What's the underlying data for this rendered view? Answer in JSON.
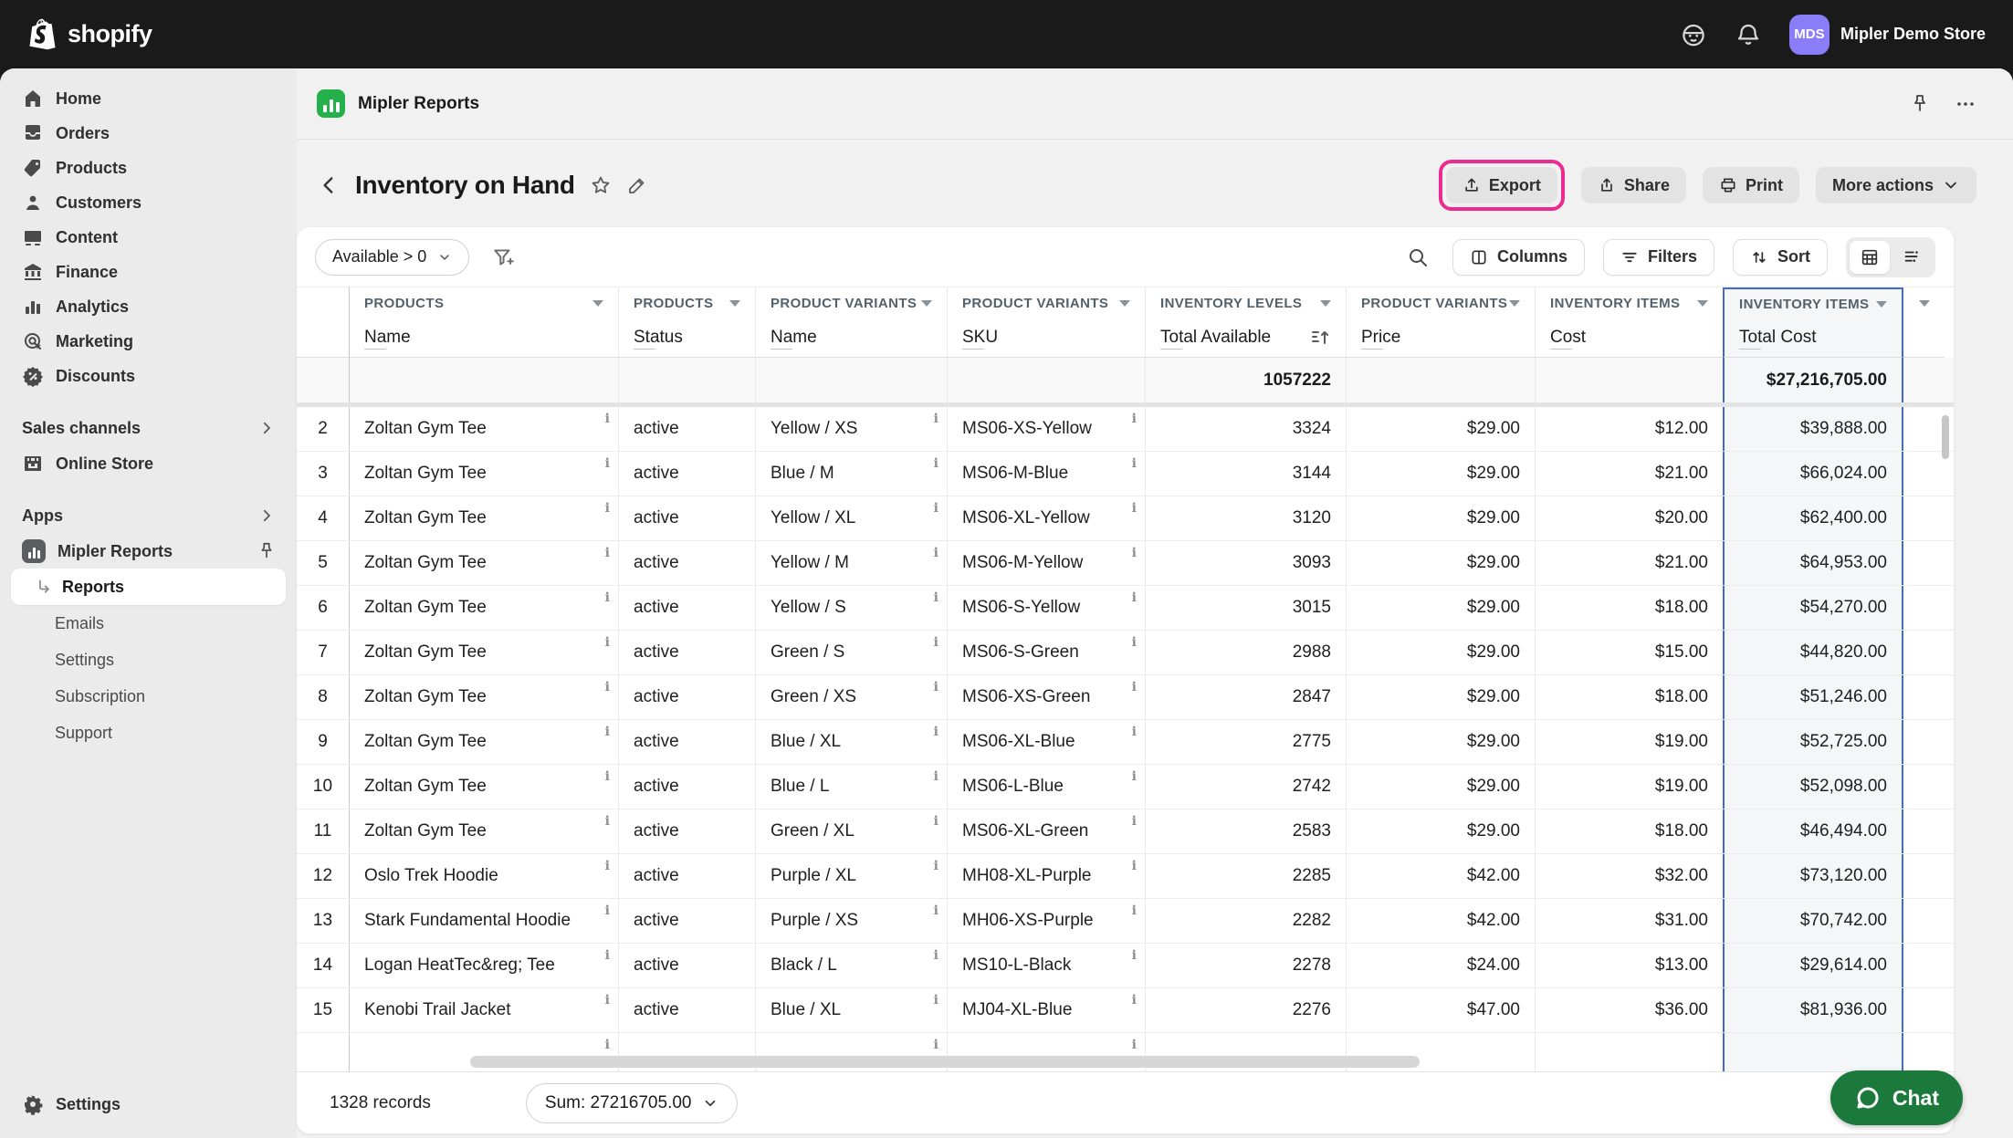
{
  "topbar": {
    "brand": "shopify",
    "store_name": "Mipler Demo Store",
    "store_initials": "MDS"
  },
  "sidebar": {
    "items": [
      {
        "label": "Home",
        "icon": "home-icon"
      },
      {
        "label": "Orders",
        "icon": "orders-icon"
      },
      {
        "label": "Products",
        "icon": "tag-icon"
      },
      {
        "label": "Customers",
        "icon": "person-icon"
      },
      {
        "label": "Content",
        "icon": "image-icon"
      },
      {
        "label": "Finance",
        "icon": "bank-icon"
      },
      {
        "label": "Analytics",
        "icon": "bar-chart-icon"
      },
      {
        "label": "Marketing",
        "icon": "target-icon"
      },
      {
        "label": "Discounts",
        "icon": "discount-badge-icon"
      }
    ],
    "sales_channels_label": "Sales channels",
    "online_store_label": "Online Store",
    "apps_label": "Apps",
    "app_name": "Mipler Reports",
    "app_items": [
      {
        "label": "Reports",
        "active": true
      },
      {
        "label": "Emails"
      },
      {
        "label": "Settings"
      },
      {
        "label": "Subscription"
      },
      {
        "label": "Support"
      }
    ],
    "settings_label": "Settings"
  },
  "appbar": {
    "title": "Mipler Reports"
  },
  "page": {
    "title": "Inventory on Hand",
    "actions": {
      "export": "Export",
      "share": "Share",
      "print": "Print",
      "more": "More actions"
    }
  },
  "toolbar": {
    "filter_chip": "Available > 0",
    "columns": "Columns",
    "filters": "Filters",
    "sort": "Sort"
  },
  "table": {
    "columns": [
      {
        "group": "PRODUCTS",
        "label": "Name"
      },
      {
        "group": "PRODUCTS",
        "label": "Status"
      },
      {
        "group": "PRODUCT VARIANTS",
        "label": "Name"
      },
      {
        "group": "PRODUCT VARIANTS",
        "label": "SKU"
      },
      {
        "group": "INVENTORY LEVELS",
        "label": "Total Available"
      },
      {
        "group": "PRODUCT VARIANTS",
        "label": "Price"
      },
      {
        "group": "INVENTORY ITEMS",
        "label": "Cost"
      },
      {
        "group": "INVENTORY ITEMS",
        "label": "Total Cost"
      }
    ],
    "summary": {
      "available": "1057222",
      "total_cost": "$27,216,705.00"
    },
    "rows": [
      {
        "num": "2",
        "name": "Zoltan Gym Tee",
        "status": "active",
        "variant": "Yellow / XS",
        "sku": "MS06-XS-Yellow",
        "available": "3324",
        "price": "$29.00",
        "cost": "$12.00",
        "total": "$39,888.00"
      },
      {
        "num": "3",
        "name": "Zoltan Gym Tee",
        "status": "active",
        "variant": "Blue / M",
        "sku": "MS06-M-Blue",
        "available": "3144",
        "price": "$29.00",
        "cost": "$21.00",
        "total": "$66,024.00"
      },
      {
        "num": "4",
        "name": "Zoltan Gym Tee",
        "status": "active",
        "variant": "Yellow / XL",
        "sku": "MS06-XL-Yellow",
        "available": "3120",
        "price": "$29.00",
        "cost": "$20.00",
        "total": "$62,400.00"
      },
      {
        "num": "5",
        "name": "Zoltan Gym Tee",
        "status": "active",
        "variant": "Yellow / M",
        "sku": "MS06-M-Yellow",
        "available": "3093",
        "price": "$29.00",
        "cost": "$21.00",
        "total": "$64,953.00"
      },
      {
        "num": "6",
        "name": "Zoltan Gym Tee",
        "status": "active",
        "variant": "Yellow / S",
        "sku": "MS06-S-Yellow",
        "available": "3015",
        "price": "$29.00",
        "cost": "$18.00",
        "total": "$54,270.00"
      },
      {
        "num": "7",
        "name": "Zoltan Gym Tee",
        "status": "active",
        "variant": "Green / S",
        "sku": "MS06-S-Green",
        "available": "2988",
        "price": "$29.00",
        "cost": "$15.00",
        "total": "$44,820.00"
      },
      {
        "num": "8",
        "name": "Zoltan Gym Tee",
        "status": "active",
        "variant": "Green / XS",
        "sku": "MS06-XS-Green",
        "available": "2847",
        "price": "$29.00",
        "cost": "$18.00",
        "total": "$51,246.00"
      },
      {
        "num": "9",
        "name": "Zoltan Gym Tee",
        "status": "active",
        "variant": "Blue / XL",
        "sku": "MS06-XL-Blue",
        "available": "2775",
        "price": "$29.00",
        "cost": "$19.00",
        "total": "$52,725.00"
      },
      {
        "num": "10",
        "name": "Zoltan Gym Tee",
        "status": "active",
        "variant": "Blue / L",
        "sku": "MS06-L-Blue",
        "available": "2742",
        "price": "$29.00",
        "cost": "$19.00",
        "total": "$52,098.00"
      },
      {
        "num": "11",
        "name": "Zoltan Gym Tee",
        "status": "active",
        "variant": "Green / XL",
        "sku": "MS06-XL-Green",
        "available": "2583",
        "price": "$29.00",
        "cost": "$18.00",
        "total": "$46,494.00"
      },
      {
        "num": "12",
        "name": "Oslo Trek Hoodie",
        "status": "active",
        "variant": "Purple / XL",
        "sku": "MH08-XL-Purple",
        "available": "2285",
        "price": "$42.00",
        "cost": "$32.00",
        "total": "$73,120.00"
      },
      {
        "num": "13",
        "name": "Stark Fundamental Hoodie",
        "status": "active",
        "variant": "Purple / XS",
        "sku": "MH06-XS-Purple",
        "available": "2282",
        "price": "$42.00",
        "cost": "$31.00",
        "total": "$70,742.00"
      },
      {
        "num": "14",
        "name": "Logan HeatTec&reg; Tee",
        "status": "active",
        "variant": "Black / L",
        "sku": "MS10-L-Black",
        "available": "2278",
        "price": "$24.00",
        "cost": "$13.00",
        "total": "$29,614.00"
      },
      {
        "num": "15",
        "name": "Kenobi Trail Jacket",
        "status": "active",
        "variant": "Blue / XL",
        "sku": "MJ04-XL-Blue",
        "available": "2276",
        "price": "$47.00",
        "cost": "$36.00",
        "total": "$81,936.00"
      }
    ]
  },
  "footer": {
    "records": "1328 records",
    "sum_label": "Sum: 27216705.00"
  },
  "chat": {
    "label": "Chat"
  },
  "colors": {
    "accent_annotation": "#ec2a8f",
    "highlight_column_border": "#4169d1",
    "chat_green": "#1b7a3b",
    "avatar_purple": "#8b7cf8",
    "app_green": "#24b04a",
    "topbar_bg": "#1a1a1a"
  }
}
